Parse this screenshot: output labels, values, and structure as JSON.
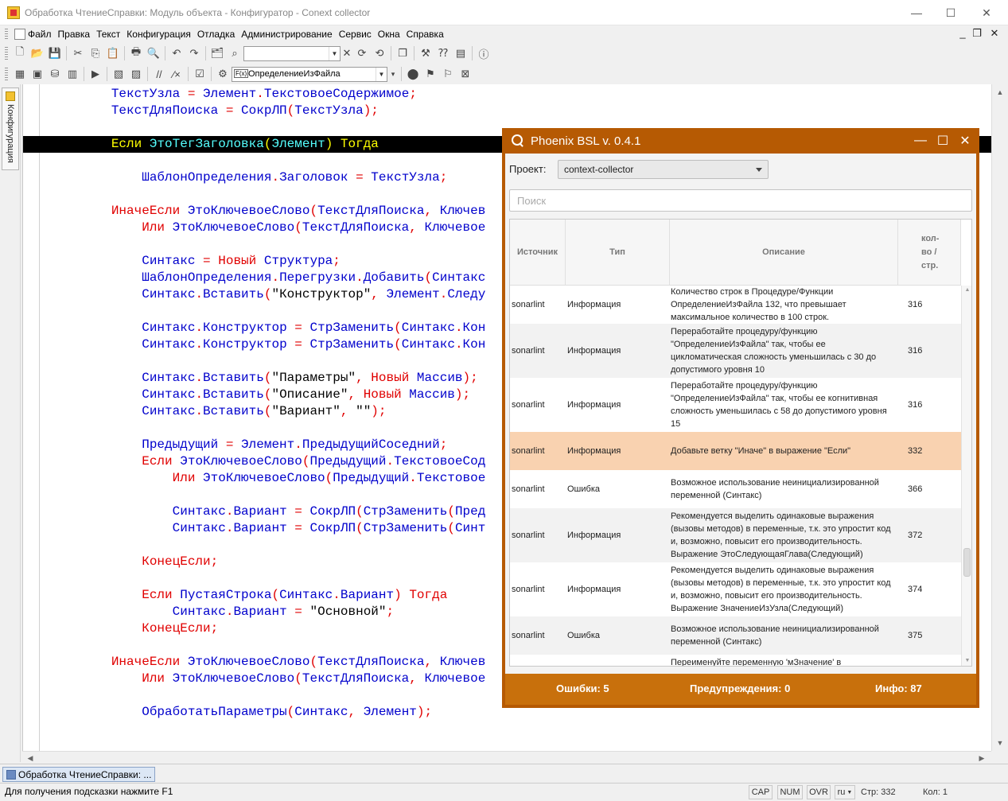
{
  "window": {
    "title": "Обработка ЧтениеСправки: Модуль объекта - Конфигуратор - Conext collector",
    "controls": {
      "minimize": "—",
      "maximize": "☐",
      "close": "✕"
    }
  },
  "menu": {
    "items": [
      "Файл",
      "Правка",
      "Текст",
      "Конфигурация",
      "Отладка",
      "Администрирование",
      "Сервис",
      "Окна",
      "Справка"
    ],
    "mdi": {
      "minimize": "_",
      "restore": "❐",
      "close": "✕"
    }
  },
  "toolbar2": {
    "function_combo": "ОпределениеИзФайла",
    "fx_label": "F(x)"
  },
  "left_panel": {
    "tab_label": "Конфигурация"
  },
  "code": {
    "lines": [
      {
        "indent": 2,
        "tokens": [
          [
            "id",
            "ТекстУзла"
          ],
          [
            "p",
            " = "
          ],
          [
            "id",
            "Элемент"
          ],
          [
            "p",
            "."
          ],
          [
            "id",
            "ТекстовоеСодержимое"
          ],
          [
            "p",
            ";"
          ]
        ]
      },
      {
        "indent": 2,
        "tokens": [
          [
            "id",
            "ТекстДляПоиска"
          ],
          [
            "p",
            " = "
          ],
          [
            "id",
            "СокрЛП"
          ],
          [
            "p",
            "("
          ],
          [
            "id",
            "ТекстУзла"
          ],
          [
            "p",
            ");"
          ]
        ]
      },
      {
        "indent": 0,
        "tokens": []
      },
      {
        "indent": 2,
        "highlight": true,
        "tokens": [
          [
            "k2",
            "Если "
          ],
          [
            "id2",
            "ЭтоТегЗаголовка"
          ],
          [
            "k2",
            "("
          ],
          [
            "id2",
            "Элемент"
          ],
          [
            "k2",
            ") "
          ],
          [
            "k2",
            "Тогда"
          ]
        ]
      },
      {
        "indent": 0,
        "tokens": []
      },
      {
        "indent": 3,
        "tokens": [
          [
            "id",
            "ШаблонОпределения"
          ],
          [
            "p",
            "."
          ],
          [
            "id",
            "Заголовок"
          ],
          [
            "p",
            " = "
          ],
          [
            "id",
            "ТекстУзла"
          ],
          [
            "p",
            ";"
          ]
        ]
      },
      {
        "indent": 0,
        "tokens": []
      },
      {
        "indent": 2,
        "tokens": [
          [
            "k",
            "ИначеЕсли "
          ],
          [
            "id",
            "ЭтоКлючевоеСлово"
          ],
          [
            "p",
            "("
          ],
          [
            "id",
            "ТекстДляПоиска"
          ],
          [
            "p",
            ", "
          ],
          [
            "id",
            "Ключев"
          ]
        ]
      },
      {
        "indent": 3,
        "tokens": [
          [
            "k",
            "Или "
          ],
          [
            "id",
            "ЭтоКлючевоеСлово"
          ],
          [
            "p",
            "("
          ],
          [
            "id",
            "ТекстДляПоиска"
          ],
          [
            "p",
            ", "
          ],
          [
            "id",
            "Ключевое"
          ]
        ]
      },
      {
        "indent": 0,
        "tokens": []
      },
      {
        "indent": 3,
        "tokens": [
          [
            "id",
            "Синтакс"
          ],
          [
            "p",
            " = "
          ],
          [
            "k",
            "Новый "
          ],
          [
            "id",
            "Структура"
          ],
          [
            "p",
            ";"
          ]
        ]
      },
      {
        "indent": 3,
        "tokens": [
          [
            "id",
            "ШаблонОпределения"
          ],
          [
            "p",
            "."
          ],
          [
            "id",
            "Перегрузки"
          ],
          [
            "p",
            "."
          ],
          [
            "id",
            "Добавить"
          ],
          [
            "p",
            "("
          ],
          [
            "id",
            "Синтакс"
          ]
        ]
      },
      {
        "indent": 3,
        "tokens": [
          [
            "id",
            "Синтакс"
          ],
          [
            "p",
            "."
          ],
          [
            "id",
            "Вставить"
          ],
          [
            "p",
            "("
          ],
          [
            "s",
            "\"Конструктор\""
          ],
          [
            "p",
            ", "
          ],
          [
            "id",
            "Элемент"
          ],
          [
            "p",
            "."
          ],
          [
            "id",
            "Следу"
          ]
        ]
      },
      {
        "indent": 0,
        "tokens": []
      },
      {
        "indent": 3,
        "tokens": [
          [
            "id",
            "Синтакс"
          ],
          [
            "p",
            "."
          ],
          [
            "id",
            "Конструктор"
          ],
          [
            "p",
            " = "
          ],
          [
            "id",
            "СтрЗаменить"
          ],
          [
            "p",
            "("
          ],
          [
            "id",
            "Синтакс"
          ],
          [
            "p",
            "."
          ],
          [
            "id",
            "Кон"
          ]
        ]
      },
      {
        "indent": 3,
        "tokens": [
          [
            "id",
            "Синтакс"
          ],
          [
            "p",
            "."
          ],
          [
            "id",
            "Конструктор"
          ],
          [
            "p",
            " = "
          ],
          [
            "id",
            "СтрЗаменить"
          ],
          [
            "p",
            "("
          ],
          [
            "id",
            "Синтакс"
          ],
          [
            "p",
            "."
          ],
          [
            "id",
            "Кон"
          ]
        ]
      },
      {
        "indent": 0,
        "tokens": []
      },
      {
        "indent": 3,
        "tokens": [
          [
            "id",
            "Синтакс"
          ],
          [
            "p",
            "."
          ],
          [
            "id",
            "Вставить"
          ],
          [
            "p",
            "("
          ],
          [
            "s",
            "\"Параметры\""
          ],
          [
            "p",
            ", "
          ],
          [
            "k",
            "Новый "
          ],
          [
            "id",
            "Массив"
          ],
          [
            "p",
            ");"
          ]
        ]
      },
      {
        "indent": 3,
        "tokens": [
          [
            "id",
            "Синтакс"
          ],
          [
            "p",
            "."
          ],
          [
            "id",
            "Вставить"
          ],
          [
            "p",
            "("
          ],
          [
            "s",
            "\"Описание\""
          ],
          [
            "p",
            ", "
          ],
          [
            "k",
            "Новый "
          ],
          [
            "id",
            "Массив"
          ],
          [
            "p",
            ");"
          ]
        ]
      },
      {
        "indent": 3,
        "tokens": [
          [
            "id",
            "Синтакс"
          ],
          [
            "p",
            "."
          ],
          [
            "id",
            "Вставить"
          ],
          [
            "p",
            "("
          ],
          [
            "s",
            "\"Вариант\""
          ],
          [
            "p",
            ", "
          ],
          [
            "s",
            "\"\""
          ],
          [
            "p",
            ");"
          ]
        ]
      },
      {
        "indent": 0,
        "tokens": []
      },
      {
        "indent": 3,
        "tokens": [
          [
            "id",
            "Предыдущий"
          ],
          [
            "p",
            " = "
          ],
          [
            "id",
            "Элемент"
          ],
          [
            "p",
            "."
          ],
          [
            "id",
            "ПредыдущийСоседний"
          ],
          [
            "p",
            ";"
          ]
        ]
      },
      {
        "indent": 3,
        "tokens": [
          [
            "k",
            "Если "
          ],
          [
            "id",
            "ЭтоКлючевоеСлово"
          ],
          [
            "p",
            "("
          ],
          [
            "id",
            "Предыдущий"
          ],
          [
            "p",
            "."
          ],
          [
            "id",
            "ТекстовоеСод"
          ]
        ]
      },
      {
        "indent": 4,
        "tokens": [
          [
            "k",
            "Или "
          ],
          [
            "id",
            "ЭтоКлючевоеСлово"
          ],
          [
            "p",
            "("
          ],
          [
            "id",
            "Предыдущий"
          ],
          [
            "p",
            "."
          ],
          [
            "id",
            "Текстовое"
          ]
        ]
      },
      {
        "indent": 0,
        "tokens": []
      },
      {
        "indent": 4,
        "tokens": [
          [
            "id",
            "Синтакс"
          ],
          [
            "p",
            "."
          ],
          [
            "id",
            "Вариант"
          ],
          [
            "p",
            " = "
          ],
          [
            "id",
            "СокрЛП"
          ],
          [
            "p",
            "("
          ],
          [
            "id",
            "СтрЗаменить"
          ],
          [
            "p",
            "("
          ],
          [
            "id",
            "Пред"
          ]
        ]
      },
      {
        "indent": 4,
        "tokens": [
          [
            "id",
            "Синтакс"
          ],
          [
            "p",
            "."
          ],
          [
            "id",
            "Вариант"
          ],
          [
            "p",
            " = "
          ],
          [
            "id",
            "СокрЛП"
          ],
          [
            "p",
            "("
          ],
          [
            "id",
            "СтрЗаменить"
          ],
          [
            "p",
            "("
          ],
          [
            "id",
            "Синт"
          ]
        ]
      },
      {
        "indent": 0,
        "tokens": []
      },
      {
        "indent": 3,
        "tokens": [
          [
            "k",
            "КонецЕсли"
          ],
          [
            "p",
            ";"
          ]
        ]
      },
      {
        "indent": 0,
        "tokens": []
      },
      {
        "indent": 3,
        "tokens": [
          [
            "k",
            "Если "
          ],
          [
            "id",
            "ПустаяСтрока"
          ],
          [
            "p",
            "("
          ],
          [
            "id",
            "Синтакс"
          ],
          [
            "p",
            "."
          ],
          [
            "id",
            "Вариант"
          ],
          [
            "p",
            ") "
          ],
          [
            "k",
            "Тогда"
          ]
        ]
      },
      {
        "indent": 4,
        "tokens": [
          [
            "id",
            "Синтакс"
          ],
          [
            "p",
            "."
          ],
          [
            "id",
            "Вариант"
          ],
          [
            "p",
            " = "
          ],
          [
            "s",
            "\"Основной\""
          ],
          [
            "p",
            ";"
          ]
        ]
      },
      {
        "indent": 3,
        "tokens": [
          [
            "k",
            "КонецЕсли"
          ],
          [
            "p",
            ";"
          ]
        ]
      },
      {
        "indent": 0,
        "tokens": []
      },
      {
        "indent": 2,
        "tokens": [
          [
            "k",
            "ИначеЕсли "
          ],
          [
            "id",
            "ЭтоКлючевоеСлово"
          ],
          [
            "p",
            "("
          ],
          [
            "id",
            "ТекстДляПоиска"
          ],
          [
            "p",
            ", "
          ],
          [
            "id",
            "Ключев"
          ]
        ]
      },
      {
        "indent": 3,
        "tokens": [
          [
            "k",
            "Или "
          ],
          [
            "id",
            "ЭтоКлючевоеСлово"
          ],
          [
            "p",
            "("
          ],
          [
            "id",
            "ТекстДляПоиска"
          ],
          [
            "p",
            ", "
          ],
          [
            "id",
            "Ключевое"
          ]
        ]
      },
      {
        "indent": 0,
        "tokens": []
      },
      {
        "indent": 3,
        "tokens": [
          [
            "id",
            "ОбработатьПараметры"
          ],
          [
            "p",
            "("
          ],
          [
            "id",
            "Синтакс"
          ],
          [
            "p",
            ", "
          ],
          [
            "id",
            "Элемент"
          ],
          [
            "p",
            ");"
          ]
        ]
      }
    ]
  },
  "phoenix": {
    "title": "Phoenix BSL v. 0.4.1",
    "project_label": "Проект:",
    "project_value": "context-collector",
    "search_placeholder": "Поиск",
    "columns": [
      "Источник",
      "Тип",
      "Описание",
      "кол-во / стр."
    ],
    "rows": [
      {
        "source": "sonarlint",
        "type": "Информация",
        "desc": "Количество строк в Процедуре/Функции ОпределениеИзФайла 132, что превышает максимальное количество в 100 строк.",
        "line": "316"
      },
      {
        "source": "sonarlint",
        "type": "Информация",
        "desc": "Переработайте процедуру/функцию \"ОпределениеИзФайла\" так, чтобы ее цикломатическая сложность уменьшилась с 30 до допустимого уровня 10",
        "line": "316"
      },
      {
        "source": "sonarlint",
        "type": "Информация",
        "desc": "Переработайте процедуру/функцию \"ОпределениеИзФайла\" так, чтобы ее когнитивная сложность уменьшилась с 58 до допустимого уровня 15",
        "line": "316"
      },
      {
        "source": "sonarlint",
        "type": "Информация",
        "desc": "Добавьте ветку \"Иначе\" в выражение \"Если\"",
        "line": "332"
      },
      {
        "source": "sonarlint",
        "type": "Ошибка",
        "desc": "Возможное использование неинициализированной переменной (Синтакс)",
        "line": "366"
      },
      {
        "source": "sonarlint",
        "type": "Информация",
        "desc": "Рекомендуется выделить одинаковые выражения (вызовы методов) в переменные, т.к. это упростит код и, возможно, повысит его производительность. Выражение ЭтоСледующаяГлава(Следующий)",
        "line": "372"
      },
      {
        "source": "sonarlint",
        "type": "Информация",
        "desc": "Рекомендуется выделить одинаковые выражения (вызовы методов) в переменные, т.к. это упростит код и, возможно, повысит его производительность. Выражение ЗначениеИзУзла(Следующий)",
        "line": "374"
      },
      {
        "source": "sonarlint",
        "type": "Ошибка",
        "desc": "Возможное использование неинициализированной переменной (Синтакс)",
        "line": "375"
      },
      {
        "source": "",
        "type": "",
        "desc": "Переименуйте переменную 'мЗначение' в",
        "line": ""
      }
    ],
    "footer": {
      "errors": "Ошибки: 5",
      "warnings": "Предупреждения: 0",
      "info": "Инфо: 87"
    }
  },
  "window_tab": "Обработка ЧтениеСправки: ...",
  "status": {
    "hint": "Для получения подсказки нажмите F1",
    "cap": "CAP",
    "num": "NUM",
    "ovr": "OVR",
    "lang": "ru",
    "line": "Стр: 332",
    "col": "Кол: 1"
  }
}
